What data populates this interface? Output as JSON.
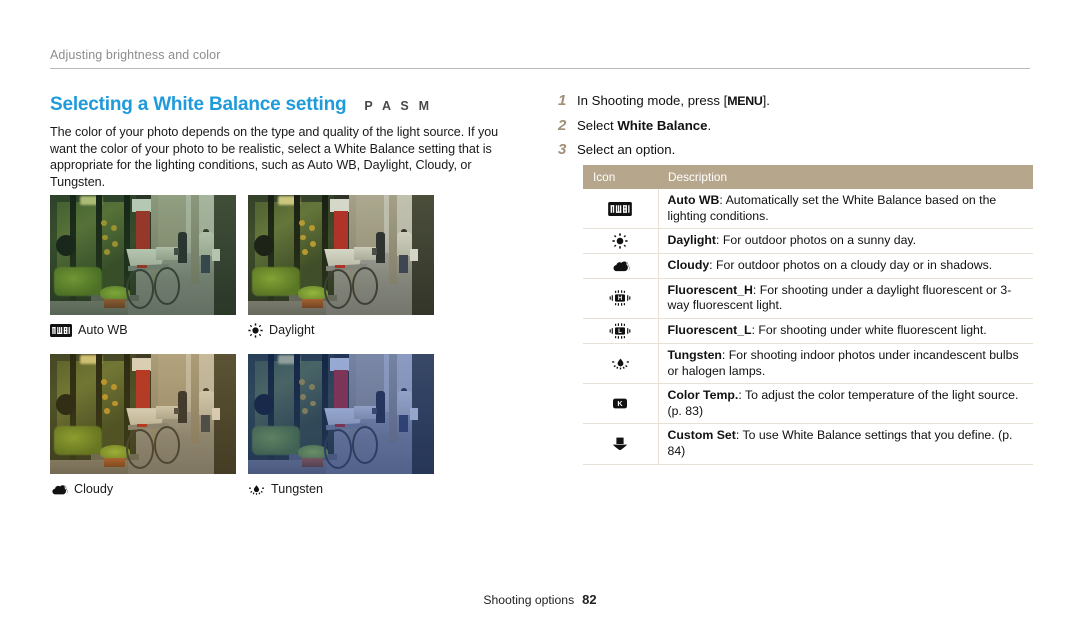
{
  "page": {
    "running_header": "Adjusting brightness and color",
    "footer_label": "Shooting options",
    "footer_page": "82",
    "accent_color": "#1f9ada",
    "table_header_color": "#b6a68c",
    "step_number_color": "#a08f76"
  },
  "section": {
    "title": "Selecting a White Balance setting",
    "modes": "P A S M",
    "body": "The color of your photo depends on the type and quality of the light source. If you want the color of your photo to be realistic, select a White Balance setting that is appropriate for the lighting conditions, such as Auto WB, Daylight, Cloudy, or Tungsten."
  },
  "samples": [
    {
      "label": "Auto WB",
      "icon": "awb-icon",
      "variant": "auto-wb"
    },
    {
      "label": "Daylight",
      "icon": "sun-icon",
      "variant": "daylight"
    },
    {
      "label": "Cloudy",
      "icon": "cloud-icon",
      "variant": "cloudy"
    },
    {
      "label": "Tungsten",
      "icon": "tungsten-icon",
      "variant": "tungsten"
    }
  ],
  "steps": [
    {
      "num": "1",
      "text_before": "In Shooting mode, press [",
      "key": "MENU",
      "text_after": "]."
    },
    {
      "num": "2",
      "text_before": "Select ",
      "bold": "White Balance",
      "text_after": "."
    },
    {
      "num": "3",
      "text_before": "Select an option.",
      "bold": "",
      "text_after": ""
    }
  ],
  "table": {
    "headers": {
      "icon": "Icon",
      "description": "Description"
    },
    "rows": [
      {
        "icon": "awb-icon",
        "term": "Auto WB",
        "sep": ":",
        "desc": " Automatically set the White Balance based on the lighting conditions."
      },
      {
        "icon": "sun-icon",
        "term": "Daylight",
        "sep": ":",
        "desc": " For outdoor photos on a sunny day."
      },
      {
        "icon": "cloud-icon",
        "term": "Cloudy",
        "sep": ":",
        "desc": " For outdoor photos on a cloudy day or in shadows."
      },
      {
        "icon": "fluorescent-h-icon",
        "term": "Fluorescent_H",
        "sep": ":",
        "desc": " For shooting under a daylight fluorescent or 3-way fluorescent light."
      },
      {
        "icon": "fluorescent-l-icon",
        "term": "Fluorescent_L",
        "sep": ":",
        "desc": " For shooting under white fluorescent light."
      },
      {
        "icon": "tungsten-icon",
        "term": "Tungsten",
        "sep": ":",
        "desc": " For shooting indoor photos under incandescent bulbs or halogen lamps."
      },
      {
        "icon": "color-temp-icon",
        "term": "Color Temp.",
        "sep": ":",
        "desc": " To adjust the color temperature of the light source. (p. 83)"
      },
      {
        "icon": "custom-set-icon",
        "term": "Custom Set",
        "sep": ":",
        "desc": " To use White Balance settings that you define. (p. 84)"
      }
    ]
  }
}
